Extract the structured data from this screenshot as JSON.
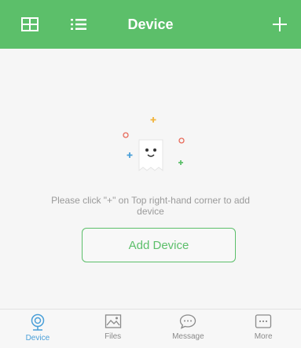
{
  "header": {
    "title": "Device",
    "left_icons": [
      "grid-view-icon",
      "list-view-icon"
    ],
    "right_icon": "plus-icon",
    "color": "#5cbf6a"
  },
  "main": {
    "empty_text": "Please click \"+\" on Top right-hand corner to add device",
    "add_button_label": "Add Device",
    "illustration": "empty-device-illustration"
  },
  "tabbar": {
    "tabs": [
      {
        "label": "Device",
        "icon": "camera-icon",
        "active": true
      },
      {
        "label": "Files",
        "icon": "image-icon",
        "active": false
      },
      {
        "label": "Message",
        "icon": "chat-icon",
        "active": false
      },
      {
        "label": "More",
        "icon": "more-icon",
        "active": false
      }
    ],
    "active_color": "#4a9fd8",
    "inactive_color": "#8a8a8a"
  }
}
